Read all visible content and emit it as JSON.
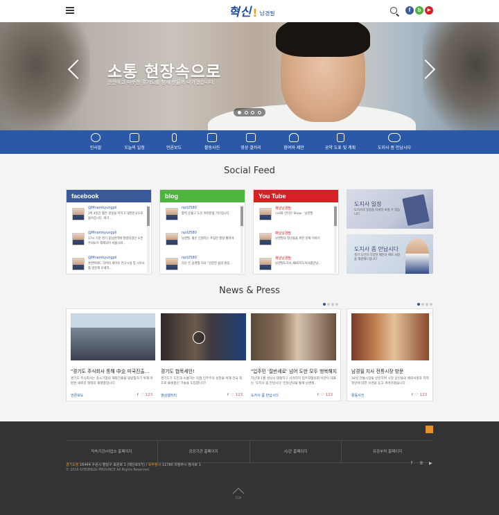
{
  "header": {
    "logo_main": "혁신",
    "logo_excl": "!",
    "logo_sub": "남경필",
    "sns": [
      {
        "icon": "facebook-icon",
        "glyph": "f",
        "color": "#3b5998"
      },
      {
        "icon": "blog-icon",
        "glyph": "b",
        "color": "#4db53d"
      },
      {
        "icon": "youtube-icon",
        "glyph": "▶",
        "color": "#d81f26"
      }
    ]
  },
  "hero": {
    "title": "소통 현장속으로",
    "subtitle": "안전하고 따뜻한 경기도를 함께 만들어 나가겠습니다."
  },
  "nav": {
    "items": [
      {
        "label": "인사말",
        "icon": "person-icon"
      },
      {
        "label": "오늘의 일정",
        "icon": "calendar-icon"
      },
      {
        "label": "언론보도",
        "icon": "microphone-icon"
      },
      {
        "label": "활동사진",
        "icon": "camera-icon"
      },
      {
        "label": "영상 갤러리",
        "icon": "film-icon"
      },
      {
        "label": "참여와 제안",
        "icon": "hand-icon"
      },
      {
        "label": "공약 도표 및 계획",
        "icon": "document-icon"
      },
      {
        "label": "도지사 좀 만납시다",
        "icon": "handshake-icon"
      }
    ]
  },
  "social": {
    "title": "Social Feed",
    "facebook": {
      "label": "facebook",
      "color": "#3b5998",
      "rows": [
        {
          "name": "@Mnamkyungpil",
          "text": "2박 4일간 짧은 일정을 마치고 대한민국으로 돌아갑니다. 여기..."
        },
        {
          "name": "@Mnamkyungpil",
          "text": "17시 기준 경기 동남권역에 발령되었던 오존 주의보가 해제되어 서울시와..."
        },
        {
          "name": "@Mnamkyungpil",
          "text": "혼변벽레드 리버의 세미로 연구시설 및 시우소를 방문해 오세하..."
        }
      ]
    },
    "blog": {
      "label": "blog",
      "color": "#4db53d",
      "rows": [
        {
          "name": "npil2580",
          "text": "활력 운율고 도민 여러분을 기다립니다"
        },
        {
          "name": "npil2580",
          "text": "남경필, 불은 인원하는 푸짐한 행정 펼쳐야"
        },
        {
          "name": "npil2580",
          "text": "라운 든 남경필 지사 \"건강한 삶의 원동..."
        }
      ]
    },
    "youtube": {
      "label": "You Tube",
      "color": "#d81f26",
      "rows": [
        {
          "name": "채널남경필",
          "text": "시사와 인터뷰 Show - 남경필"
        },
        {
          "name": "채널남경필",
          "text": "남경필의 청년들을 위한 진짜 이야기"
        },
        {
          "name": "채널남경필",
          "text": "남경필도지사,제85차도지사좀만남..."
        }
      ]
    },
    "promos": [
      {
        "title": "도지사 일정",
        "text": "도지사의 일정을 자세히 보실 수 있습니다"
      },
      {
        "title": "도지사 좀 만납시다",
        "text": "경기 도민의 다양한 제안과 애로 사항을 해결해드립니다"
      }
    ]
  },
  "news": {
    "title": "News & Press",
    "items": [
      {
        "title": "\"경기도 주식회사 통해 中企 미국진출...",
        "text": "경기도 주식회사는 중소기업의 해외진출을 뒷받침하기 위해 마련된 새로운 형태의 플랫폼입니다.",
        "category": "언론보도",
        "likes": "123"
      },
      {
        "title": "경기도 협목세인!",
        "text": "경기도가 도민과 소통하는 직접 민주주의 실현을 위해 전국 최초로 플랫폼인 기술을 도입합니다!",
        "category": "영상갤러리",
        "likes": "123"
      },
      {
        "title": "\"입주민 '절반세로' 넘어 도만 모두 행복해지..",
        "text": "지난해 1월 성남시 태평지구 사려하지 입주자협의회 이관이 대표는 '도지사 좀 만납시다' 민원상담을 통해 남경필..",
        "category": "도지사 좀 만납시다",
        "likes": "123"
      },
      {
        "title": "남경필 지사 전통시장 방문",
        "text": "18일 전통시장을 방문하여 시장 상인들의 애로사항과 지역현안에 대한 의견을 듣고 격려하였습니다.",
        "category": "활동사진",
        "likes": "123"
      }
    ]
  },
  "footer": {
    "links": [
      "직속기관/사업소 홈페이지",
      "공공기관 홈페이지",
      "시/군 홈페이지",
      "유관부처 홈페이지"
    ],
    "addr_label1": "경기도청",
    "addr1": "16444 수원시 팔달구 효원로 1 (매산로3가)",
    "addr_label2": "북부청사",
    "addr2": "11780 의정부시 청사로 1",
    "copyright": "© 2016 GYEONGGI PROVINCE All Rights Reserved.",
    "top_label": "TOP",
    "sns": [
      "f",
      "B",
      "▶"
    ]
  }
}
